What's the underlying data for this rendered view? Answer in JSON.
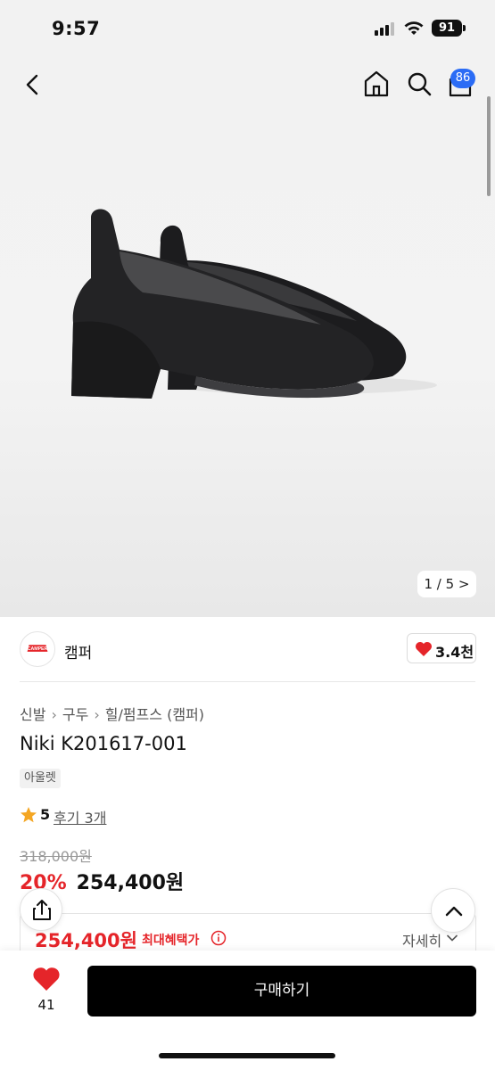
{
  "status_bar": {
    "time": "9:57",
    "battery": "91"
  },
  "header": {
    "cart_count": "86"
  },
  "gallery": {
    "pager": "1 / 5 >"
  },
  "brand": {
    "logo_text": "CAMPER",
    "name": "캠퍼",
    "likes": "3.4천"
  },
  "breadcrumb": [
    "신발",
    "구두",
    "힐/펌프스 (캠퍼)"
  ],
  "product": {
    "title": "Niki K201617-001",
    "tag": "아울렛",
    "rating": "5",
    "reviews": "후기 3개",
    "original_price": "318,000원",
    "discount": "20%",
    "sale_price": "254,400원"
  },
  "benefit": {
    "price": "254,400원",
    "label": "최대혜택가",
    "detail": "자세히"
  },
  "bottom": {
    "wish_count": "41",
    "buy_label": "구매하기"
  },
  "colors": {
    "accent_red": "#e5252a",
    "badge_blue": "#2b6cf5",
    "buy_button": "#000000"
  }
}
